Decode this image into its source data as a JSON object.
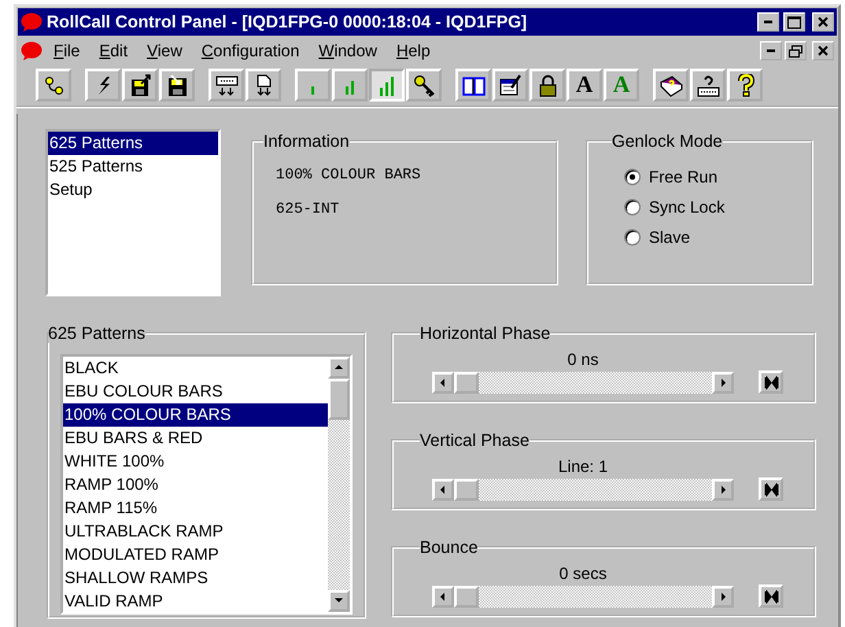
{
  "window": {
    "title": "RollCall Control Panel - [IQD1FPG-0 0000:18:04 - IQD1FPG]"
  },
  "menu": [
    {
      "label": "File"
    },
    {
      "label": "Edit"
    },
    {
      "label": "View"
    },
    {
      "label": "Configuration"
    },
    {
      "label": "Window"
    },
    {
      "label": "Help"
    }
  ],
  "toolbar": [
    [
      {
        "pressed": false
      }
    ],
    [
      {
        "pressed": false
      },
      {
        "pressed": false
      },
      {
        "pressed": false
      }
    ],
    [
      {
        "pressed": false
      },
      {
        "pressed": false
      }
    ],
    [
      {
        "pressed": false
      },
      {
        "pressed": false
      },
      {
        "pressed": true
      },
      {
        "pressed": false
      }
    ],
    [
      {
        "pressed": false
      },
      {
        "pressed": false
      },
      {
        "pressed": false
      },
      {
        "label": "A",
        "color": "#000000",
        "pressed": false
      },
      {
        "label": "A",
        "color": "#008000",
        "pressed": false
      }
    ],
    [
      {
        "pressed": false
      },
      {
        "pressed": false
      },
      {
        "pressed": false
      }
    ]
  ],
  "sections": [
    {
      "label": "625 Patterns",
      "selected": true
    },
    {
      "label": "525 Patterns",
      "selected": false
    },
    {
      "label": "Setup",
      "selected": false
    }
  ],
  "information": {
    "title": "Information",
    "lines": [
      "100% COLOUR BARS",
      "625-INT"
    ]
  },
  "genlock": {
    "title": "Genlock Mode",
    "options": [
      {
        "label": "Free Run",
        "selected": true
      },
      {
        "label": "Sync Lock",
        "selected": false
      },
      {
        "label": "Slave",
        "selected": false
      }
    ]
  },
  "patterns": {
    "title": "625 Patterns",
    "items": [
      {
        "label": "BLACK",
        "selected": false
      },
      {
        "label": "EBU COLOUR BARS",
        "selected": false
      },
      {
        "label": "100% COLOUR BARS",
        "selected": true
      },
      {
        "label": "EBU BARS & RED",
        "selected": false
      },
      {
        "label": "WHITE 100%",
        "selected": false
      },
      {
        "label": "RAMP 100%",
        "selected": false
      },
      {
        "label": "RAMP 115%",
        "selected": false
      },
      {
        "label": "ULTRABLACK RAMP",
        "selected": false
      },
      {
        "label": "MODULATED RAMP",
        "selected": false
      },
      {
        "label": "SHALLOW RAMPS",
        "selected": false
      },
      {
        "label": "VALID RAMP",
        "selected": false
      }
    ]
  },
  "sliders": [
    {
      "title": "Horizontal Phase",
      "reading": "0 ns",
      "level": 0
    },
    {
      "title": "Vertical Phase",
      "reading": "Line: 1",
      "level": 0
    },
    {
      "title": "Bounce",
      "reading": "0 secs",
      "level": 0
    }
  ]
}
